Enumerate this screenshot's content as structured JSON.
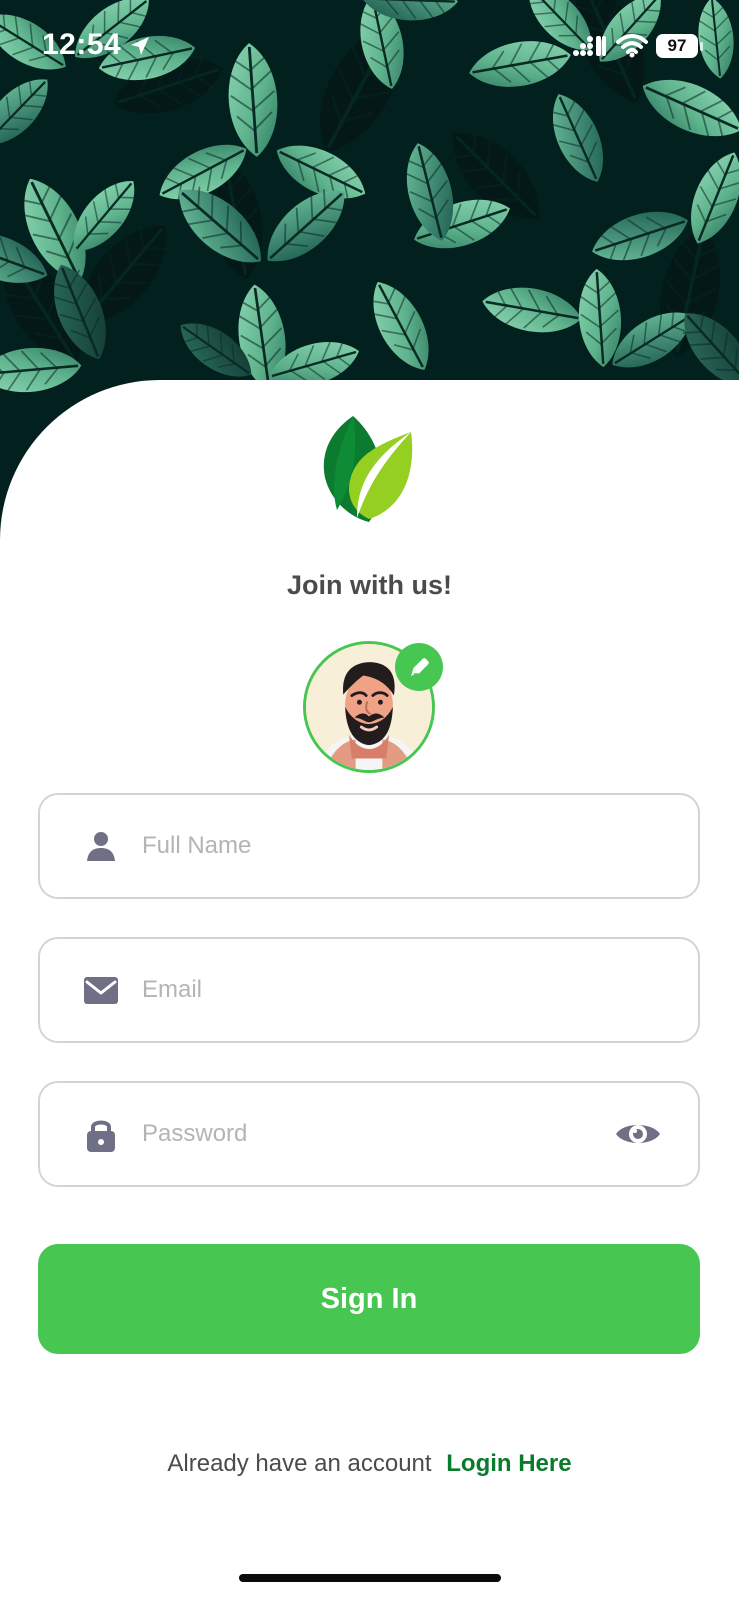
{
  "status_bar": {
    "time": "12:54",
    "battery": "97"
  },
  "signup": {
    "title": "Join with us!",
    "fields": {
      "full_name": {
        "placeholder": "Full Name",
        "value": ""
      },
      "email": {
        "placeholder": "Email",
        "value": ""
      },
      "password": {
        "placeholder": "Password",
        "value": ""
      }
    },
    "sign_in_label": "Sign In",
    "account_prompt": "Already have an account",
    "login_label": "Login Here"
  },
  "icons": {
    "location": "location-arrow-icon",
    "signal": "cellular-signal-icon",
    "wifi": "wifi-icon",
    "logo": "leaf-logo-icon",
    "edit_avatar": "pencil-icon",
    "full_name": "user-icon",
    "email": "mail-icon",
    "password": "lock-icon",
    "show_password": "eye-icon"
  },
  "colors": {
    "accent": "#47C652",
    "link": "#087B2D",
    "background_dark": "#02201D",
    "field_border": "#D4D4D4",
    "icon_gray": "#6F6F85",
    "text_dark": "#4B4B4B"
  }
}
